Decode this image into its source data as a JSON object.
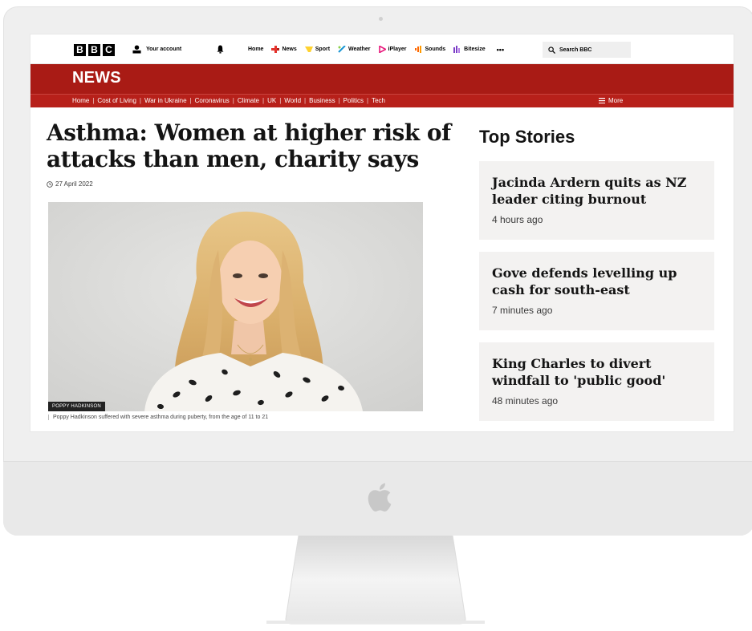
{
  "topbar": {
    "logo_letters": [
      "B",
      "B",
      "C"
    ],
    "account_label": "Your account",
    "nav": [
      {
        "label": "Home",
        "icon": "none",
        "color": "#000000"
      },
      {
        "label": "News",
        "icon": "news-icon",
        "color": "#e4322b"
      },
      {
        "label": "Sport",
        "icon": "sport-icon",
        "color": "#ffd230"
      },
      {
        "label": "Weather",
        "icon": "weather-icon",
        "color": "#1b96d4"
      },
      {
        "label": "iPlayer",
        "icon": "iplayer-icon",
        "color": "#e8197c"
      },
      {
        "label": "Sounds",
        "icon": "sounds-icon",
        "color": "#ff6600"
      },
      {
        "label": "Bitesize",
        "icon": "bitesize-icon",
        "color": "#7c3ec7"
      }
    ],
    "more_dots": "•••",
    "search_placeholder": "Search BBC"
  },
  "newsbar": {
    "title": "NEWS",
    "sections": [
      "Home",
      "Cost of Living",
      "War in Ukraine",
      "Coronavirus",
      "Climate",
      "UK",
      "World",
      "Business",
      "Politics",
      "Tech"
    ],
    "more_label": "More"
  },
  "article": {
    "headline": "Asthma: Women at higher risk of attacks than men, charity says",
    "date": "27 April 2022",
    "image_credit": "POPPY HADKINSON",
    "caption": "Poppy Hadkinson suffered with severe asthma during puberty, from the age of 11 to 21"
  },
  "top_stories": {
    "title": "Top Stories",
    "items": [
      {
        "headline": "Jacinda Ardern quits as NZ leader citing burnout",
        "time": "4 hours ago"
      },
      {
        "headline": "Gove defends levelling up cash for south-east",
        "time": "7 minutes ago"
      },
      {
        "headline": "King Charles to divert windfall to 'public good'",
        "time": "48 minutes ago"
      }
    ]
  },
  "colors": {
    "news_red": "#a91b15",
    "subnav_red": "#b7201a",
    "story_bg": "#f3f2f1"
  }
}
